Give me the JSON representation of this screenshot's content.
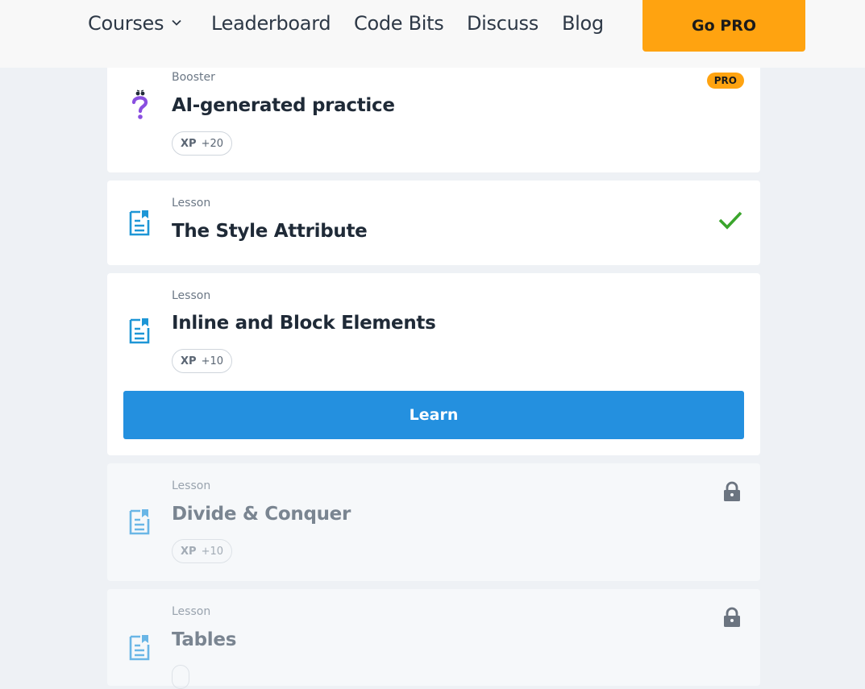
{
  "nav": {
    "courses": "Courses",
    "leaderboard": "Leaderboard",
    "code_bits": "Code Bits",
    "discuss": "Discuss",
    "blog": "Blog",
    "go_pro": "Go PRO"
  },
  "colors": {
    "accent_orange": "#ffa310",
    "primary_blue": "#2490df",
    "lesson_icon_blue": "#1e96d6",
    "check_green": "#3aa52c",
    "booster_purple": "#8a4fe0"
  },
  "cards": {
    "booster": {
      "type": "Booster",
      "title": "AI-generated practice",
      "xp_label": "XP",
      "xp_value": "+20",
      "badge": "PRO",
      "icon": "question-icon"
    },
    "style_attribute": {
      "type": "Lesson",
      "title": "The Style Attribute",
      "status": "completed",
      "icon": "lesson-document-icon"
    },
    "inline_block": {
      "type": "Lesson",
      "title": "Inline and Block Elements",
      "xp_label": "XP",
      "xp_value": "+10",
      "button": "Learn",
      "icon": "lesson-document-icon"
    },
    "divide_conquer": {
      "type": "Lesson",
      "title": "Divide & Conquer",
      "xp_label": "XP",
      "xp_value": "+10",
      "status": "locked",
      "icon": "lesson-document-icon"
    },
    "tables": {
      "type": "Lesson",
      "title": "Tables",
      "status": "locked",
      "icon": "lesson-document-icon"
    }
  }
}
